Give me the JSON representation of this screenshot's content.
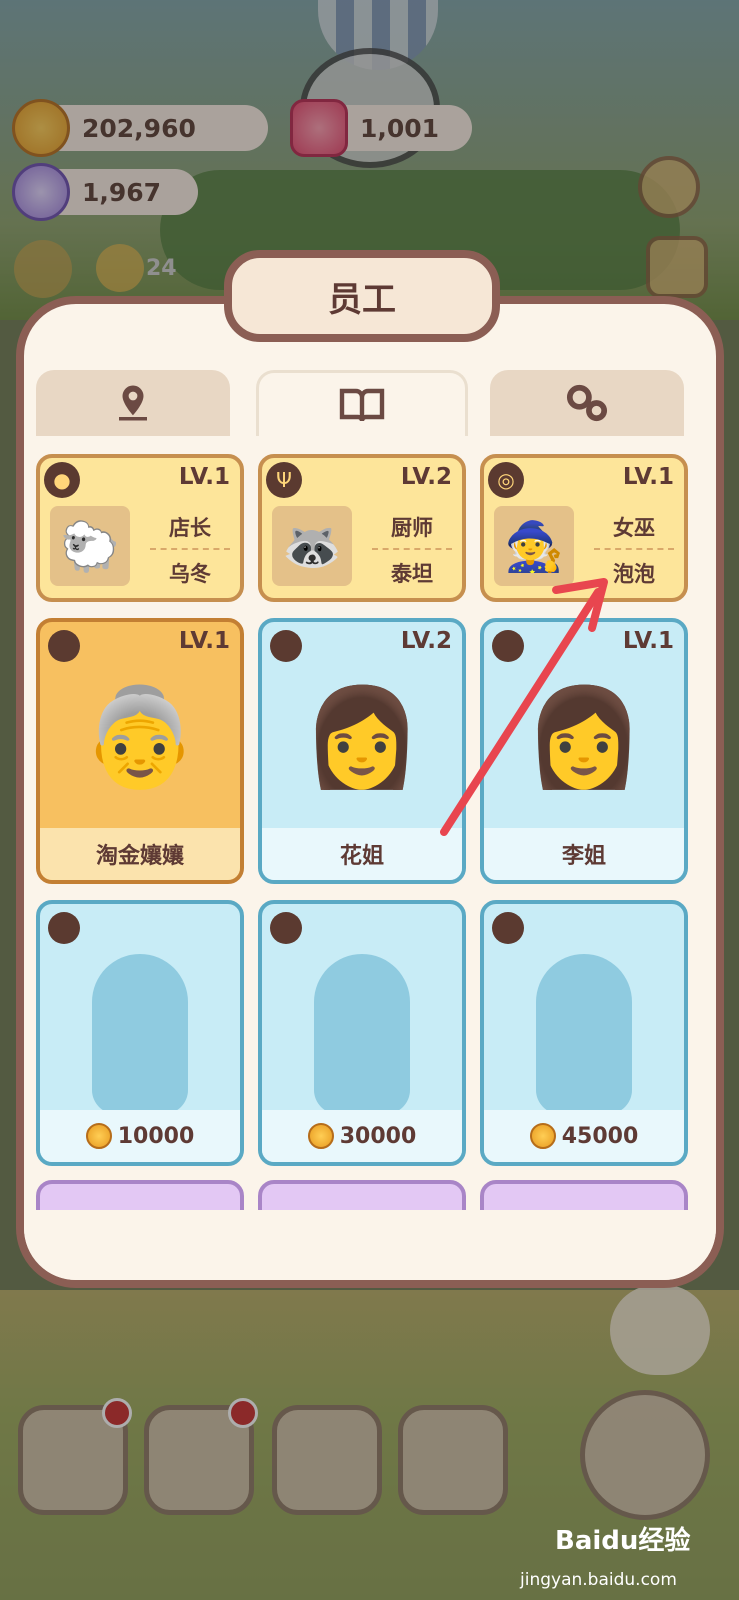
{
  "resources": [
    {
      "id": "coins",
      "value": "202,960",
      "icon": "coin-icon"
    },
    {
      "id": "gems",
      "value": "1,001",
      "icon": "gem-icon"
    },
    {
      "id": "candy",
      "value": "1,967",
      "icon": "candy-icon"
    }
  ],
  "hud": {
    "helper_count": "24"
  },
  "modal": {
    "title": "员工",
    "tabs": [
      {
        "icon": "map-pin-icon",
        "active": false
      },
      {
        "icon": "book-icon",
        "active": true
      },
      {
        "icon": "gears-icon",
        "active": false
      }
    ]
  },
  "staff": [
    {
      "level": "LV.1",
      "role": "店长",
      "name": "乌冬",
      "role_icon": "cookie-icon"
    },
    {
      "level": "LV.2",
      "role": "厨师",
      "name": "泰坦",
      "role_icon": "utensils-icon"
    },
    {
      "level": "LV.1",
      "role": "女巫",
      "name": "泡泡",
      "role_icon": "cauldron-icon"
    }
  ],
  "characters": [
    {
      "level": "LV.1",
      "name": "淘金孃孃",
      "style": "gold"
    },
    {
      "level": "LV.2",
      "name": "花姐",
      "style": "blue"
    },
    {
      "level": "LV.1",
      "name": "李姐",
      "style": "blue"
    }
  ],
  "locked": [
    {
      "price": "10000"
    },
    {
      "price": "30000"
    },
    {
      "price": "45000"
    }
  ],
  "watermark": {
    "brand": "Baidu经验",
    "url": "jingyan.baidu.com"
  },
  "colors": {
    "accent": "#8b5e54",
    "arrow": "#e8464f"
  }
}
